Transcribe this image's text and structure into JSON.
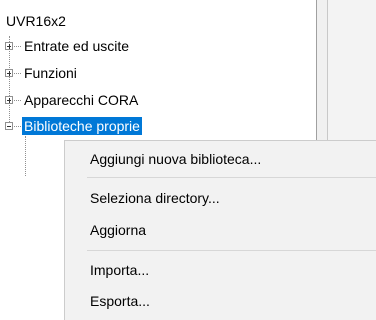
{
  "tree": {
    "root_label": "UVR16x2",
    "nodes": [
      {
        "label": "Entrate ed uscite",
        "expander": "plus",
        "selected": false
      },
      {
        "label": "Funzioni",
        "expander": "plus",
        "selected": false
      },
      {
        "label": "Apparecchi CORA",
        "expander": "plus",
        "selected": false
      },
      {
        "label": "Biblioteche proprie",
        "expander": "minus",
        "selected": true
      }
    ]
  },
  "context_menu": {
    "items": [
      {
        "label": "Aggiungi nuova biblioteca..."
      },
      {
        "label": "Seleziona directory..."
      },
      {
        "label": "Aggiorna"
      },
      {
        "label": "Importa..."
      },
      {
        "label": "Esporta..."
      }
    ]
  },
  "colors": {
    "selection": "#0078d7",
    "menu_background": "#f2f2f2"
  }
}
